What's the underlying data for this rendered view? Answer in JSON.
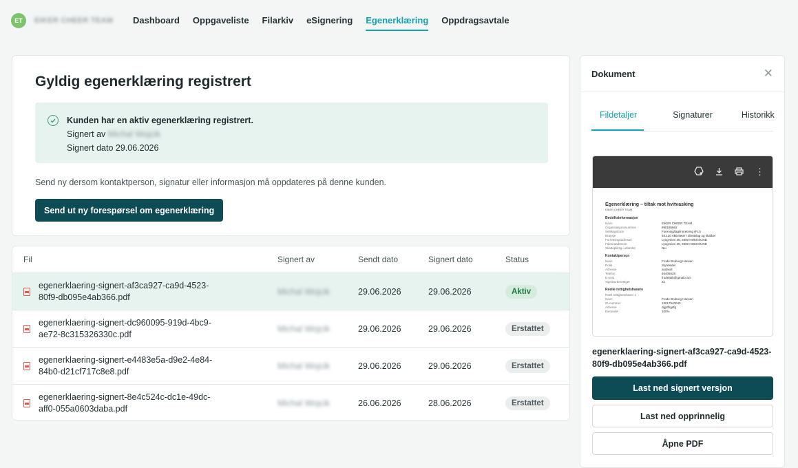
{
  "nav": {
    "avatar_initials": "ET",
    "team_name": "EIKER CHEER TEAM",
    "items": [
      {
        "label": "Dashboard",
        "active": false
      },
      {
        "label": "Oppgaveliste",
        "active": false
      },
      {
        "label": "Filarkiv",
        "active": false
      },
      {
        "label": "eSignering",
        "active": false
      },
      {
        "label": "Egenerklæring",
        "active": true
      },
      {
        "label": "Oppdragsavtale",
        "active": false
      }
    ]
  },
  "main": {
    "title": "Gyldig egenerklæring registrert",
    "alert": {
      "heading": "Kunden har en aktiv egenerklæring registrert.",
      "signed_by_label": "Signert av",
      "signed_by_name": "Michal Wojcik",
      "signed_date": "Signert dato 29.06.2026"
    },
    "help_text": "Send ny dersom kontaktperson, signatur eller informasjon må oppdateres på denne kunden.",
    "send_button": "Send ut ny forespørsel om egenerklæring"
  },
  "table": {
    "headers": {
      "file": "Fil",
      "signed_by": "Signert av",
      "sent_date": "Sendt dato",
      "signed_date": "Signert dato",
      "status": "Status"
    },
    "rows": [
      {
        "file": "egenerklaering-signert-af3ca927-ca9d-4523-80f9-db095e4ab366.pdf",
        "signed_by": "Michal Wojcik",
        "sent": "29.06.2026",
        "signed": "29.06.2026",
        "status": "Aktiv"
      },
      {
        "file": "egenerklaering-signert-dc960095-919d-4bc9-ae72-8c315326330c.pdf",
        "signed_by": "Michal Wojcik",
        "sent": "29.06.2026",
        "signed": "29.06.2026",
        "status": "Erstattet"
      },
      {
        "file": "egenerklaering-signert-e4483e5a-d9e2-4e84-84b0-d21cf717c8e8.pdf",
        "signed_by": "Michal Wojcik",
        "sent": "29.06.2026",
        "signed": "29.06.2026",
        "status": "Erstattet"
      },
      {
        "file": "egenerklaering-signert-8e4c524c-dc1e-49dc-aff0-055a0603daba.pdf",
        "signed_by": "Michal Wojcik",
        "sent": "26.06.2026",
        "signed": "28.06.2026",
        "status": "Erstattet"
      }
    ]
  },
  "side": {
    "title": "Dokument",
    "close_icon": "close-icon",
    "tabs": [
      {
        "label": "Fildetaljer",
        "active": true
      },
      {
        "label": "Signaturer",
        "active": false
      },
      {
        "label": "Historikk",
        "active": false
      }
    ],
    "preview": {
      "doc_title": "Egenerklæring – tiltak mot hvitvasking",
      "doc_subtitle": "EIKER CHEER TEAM",
      "sections": [
        {
          "title": "Bedriftsinformasjon",
          "lines": [
            [
              "Navn",
              "EIKER CHEER TEAM"
            ],
            [
              "Organisasjonsnummer",
              "990185662"
            ],
            [
              "Selskapsform",
              "Forening/lag/innretning (FLI)"
            ],
            [
              "Bransje",
              "93.130 Aktiviteter i idrettslag og klubber"
            ],
            [
              "Forretningsadresse",
              "Lyngveien 48, 3300 HOKKSUND"
            ],
            [
              "Fakturaadresse",
              "Lyngveien 48, 3300 HOKKSUND"
            ],
            [
              "Skattepliktig i utlandet",
              "Nei"
            ]
          ]
        },
        {
          "title": "Kontaktperson",
          "lines": [
            [
              "Navn",
              "Frode Bruborg Hansen"
            ],
            [
              "Rolle",
              "Styreleder"
            ],
            [
              "Adresse",
              "asdasdi"
            ],
            [
              "Telefon",
              "46405528"
            ],
            [
              "E-post",
              "frodeabh@gmail.com"
            ],
            [
              "Signaturberettiget",
              "Ja"
            ]
          ]
        },
        {
          "title": "Reelle rettighetshavere",
          "lines": [
            [
              "Reell rettighetshaver 1",
              ""
            ],
            [
              "Navn",
              "Frode Bruborg Hansen"
            ],
            [
              "ID-nummer",
              "13017540040"
            ],
            [
              "Adresse",
              "dgjdfhgdfg"
            ],
            [
              "Eierandel",
              "100%"
            ]
          ]
        }
      ]
    },
    "file_name": "egenerklaering-signert-af3ca927-ca9d-4523-80f9-db095e4ab366.pdf",
    "download_signed": "Last ned signert versjon",
    "download_original": "Last ned opprinnelig",
    "open_pdf": "Åpne PDF"
  },
  "colors": {
    "accent": "#14a3b0",
    "primary_button": "#0e4c55",
    "success_bg": "#e7f3ee"
  }
}
